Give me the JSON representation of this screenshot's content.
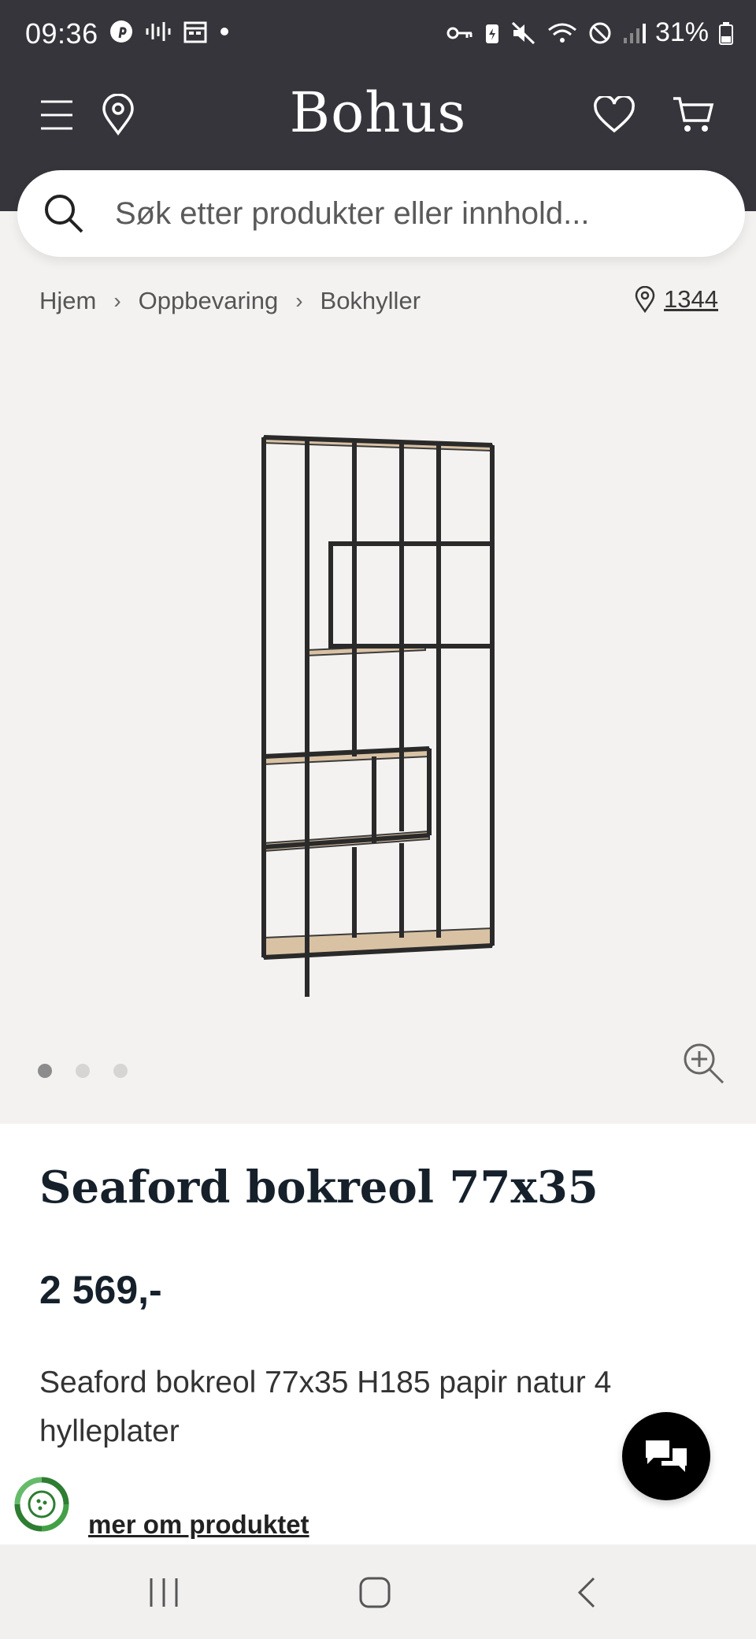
{
  "status": {
    "time": "09:36",
    "battery": "31%"
  },
  "header": {
    "brand": "Bohus",
    "icons": [
      "menu-icon",
      "location-pin-icon",
      "heart-icon",
      "cart-icon"
    ]
  },
  "search": {
    "placeholder": "Søk etter produkter eller innhold..."
  },
  "breadcrumb": {
    "items": [
      "Hjem",
      "Oppbevaring",
      "Bokhyller"
    ],
    "separator": "›",
    "store": "1344"
  },
  "gallery": {
    "image_count": 3,
    "active_index": 0
  },
  "product": {
    "title": "Seaford bokreol 77x35",
    "price": "2 569,-",
    "description": "Seaford bokreol 77x35 H185 papir natur 4 hylleplater",
    "more_link": "mer om produktet"
  },
  "colors": {
    "header_bg": "#35353b",
    "page_bg": "#f4f2f0",
    "text_dark": "#15202b",
    "eco_green": "#2e7d32"
  }
}
